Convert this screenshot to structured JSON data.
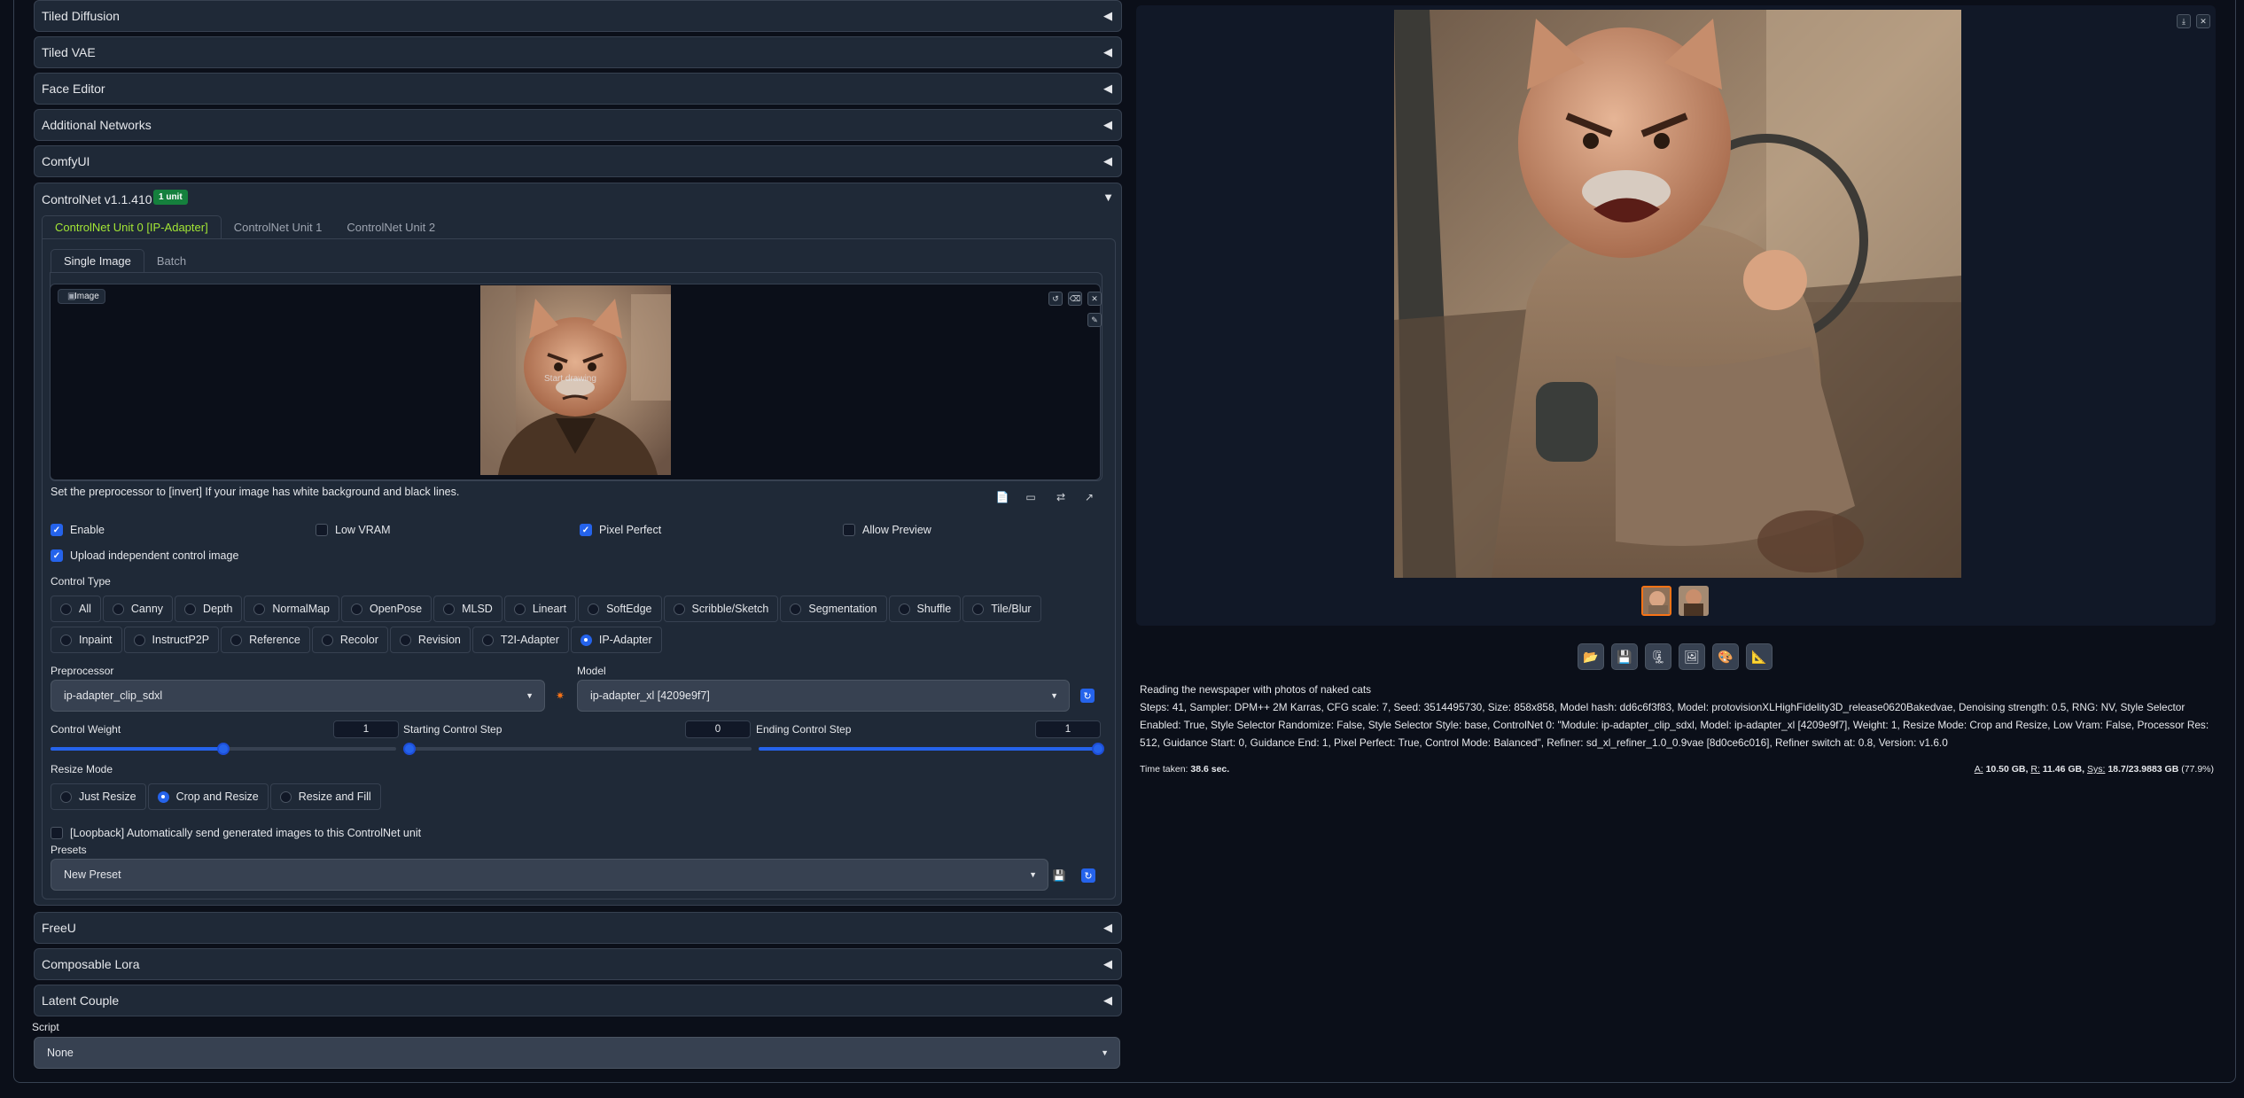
{
  "accordions_top": [
    "Tiled Diffusion",
    "Tiled VAE",
    "Face Editor",
    "Additional Networks",
    "ComfyUI"
  ],
  "accordions_bottom": [
    "FreeU",
    "Composable Lora",
    "Latent Couple"
  ],
  "controlnet": {
    "title": "ControlNet v1.1.410",
    "badge": "1 unit",
    "unit_tabs": [
      "ControlNet Unit 0 [IP-Adapter]",
      "ControlNet Unit 1",
      "ControlNet Unit 2"
    ],
    "image_tabs": [
      "Single Image",
      "Batch"
    ],
    "image_label": "Image",
    "canvas_hint": "Start drawing",
    "hint_text": "Set the preprocessor to [invert] If your image has white background and black lines.",
    "checks": {
      "enable": "Enable",
      "low_vram": "Low VRAM",
      "pixel_perfect": "Pixel Perfect",
      "allow_preview": "Allow Preview",
      "upload_independent": "Upload independent control image",
      "loopback": "[Loopback] Automatically send generated images to this ControlNet unit"
    },
    "control_type_label": "Control Type",
    "control_types_row1": [
      "All",
      "Canny",
      "Depth",
      "NormalMap",
      "OpenPose",
      "MLSD",
      "Lineart",
      "SoftEdge",
      "Scribble/Sketch",
      "Segmentation",
      "Shuffle",
      "Tile/Blur"
    ],
    "control_types_row2": [
      "Inpaint",
      "InstructP2P",
      "Reference",
      "Recolor",
      "Revision",
      "T2I-Adapter",
      "IP-Adapter"
    ],
    "selected_control_type": "IP-Adapter",
    "preprocessor_label": "Preprocessor",
    "preprocessor_value": "ip-adapter_clip_sdxl",
    "model_label": "Model",
    "model_value": "ip-adapter_xl [4209e9f7]",
    "control_weight_label": "Control Weight",
    "control_weight": "1",
    "start_step_label": "Starting Control Step",
    "start_step": "0",
    "end_step_label": "Ending Control Step",
    "end_step": "1",
    "slider_levels": {
      "control_weight": 0.5,
      "start_step": 0.0,
      "end_step": 1.0
    },
    "resize_mode_label": "Resize Mode",
    "resize_modes": [
      "Just Resize",
      "Crop and Resize",
      "Resize and Fill"
    ],
    "selected_resize_mode": "Crop and Resize",
    "presets_label": "Presets",
    "preset_value": "New Preset"
  },
  "script": {
    "label": "Script",
    "value": "None"
  },
  "output": {
    "prompt": "Reading the newspaper with photos of naked cats",
    "params": "Steps: 41, Sampler: DPM++ 2M Karras, CFG scale: 7, Seed: 3514495730, Size: 858x858, Model hash: dd6c6f3f83, Model: protovisionXLHighFidelity3D_release0620Bakedvae, Denoising strength: 0.5, RNG: NV, Style Selector Enabled: True, Style Selector Randomize: False, Style Selector Style: base, ControlNet 0: \"Module: ip-adapter_clip_sdxl, Model: ip-adapter_xl [4209e9f7], Weight: 1, Resize Mode: Crop and Resize, Low Vram: False, Processor Res: 512, Guidance Start: 0, Guidance End: 1, Pixel Perfect: True, Control Mode: Balanced\", Refiner: sd_xl_refiner_1.0_0.9vae [8d0ce6c016], Refiner switch at: 0.8, Version: v1.6.0",
    "time_label": "Time taken:",
    "time_value": "38.6 sec.",
    "vram_a_label": "A:",
    "vram_a": "10.50 GB,",
    "vram_r_label": "R:",
    "vram_r": "11.46 GB,",
    "vram_sys_label": "Sys:",
    "vram_sys": "18.7/23.9883 GB",
    "vram_pct": "(77.9%)"
  },
  "colors": {
    "accent": "#2563eb",
    "active_tab": "#a3e635",
    "badge": "#15803d",
    "bg": "#0b0f19",
    "panel": "#1f2937"
  }
}
